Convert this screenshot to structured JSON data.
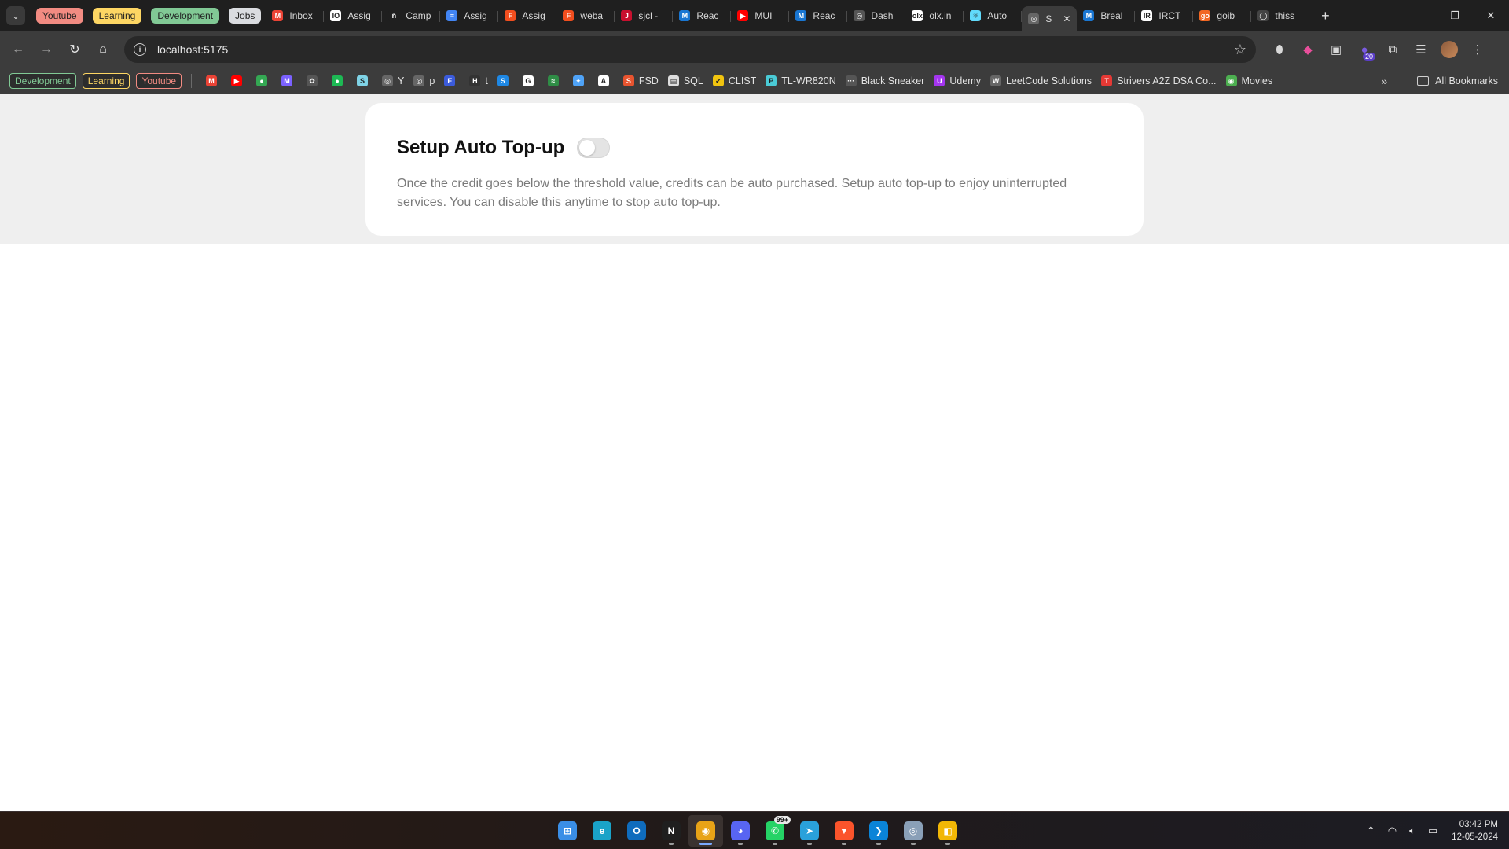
{
  "browser": {
    "tab_groups": [
      {
        "label": "Youtube",
        "bg": "#f28b82"
      },
      {
        "label": "Learning",
        "bg": "#fdd663"
      },
      {
        "label": "Development",
        "bg": "#81c995"
      },
      {
        "label": "Jobs",
        "bg": "#dadce0"
      }
    ],
    "tabs": [
      {
        "label": "Inbox",
        "icon": "gmail-icon",
        "color": "#ea4335",
        "glyph": "M"
      },
      {
        "label": "Assig",
        "icon": "assignment-icon",
        "color": "#ffffff",
        "glyph": "IO"
      },
      {
        "label": "Camp",
        "icon": "camp-icon",
        "color": "#1f1f1f",
        "glyph": "ñ"
      },
      {
        "label": "Assig",
        "icon": "docs-icon",
        "color": "#4285f4",
        "glyph": "≡"
      },
      {
        "label": "Assig",
        "icon": "figma-icon",
        "color": "#f24e1e",
        "glyph": "F"
      },
      {
        "label": "weba",
        "icon": "figma-icon",
        "color": "#f24e1e",
        "glyph": "F"
      },
      {
        "label": "sjcl -",
        "icon": "sjcl-icon",
        "color": "#c8102e",
        "glyph": "J"
      },
      {
        "label": "Reac",
        "icon": "mui-icon",
        "color": "#1976d2",
        "glyph": "M"
      },
      {
        "label": "MUI",
        "icon": "youtube-icon",
        "color": "#ff0000",
        "glyph": "▶"
      },
      {
        "label": "Reac",
        "icon": "mui-icon",
        "color": "#1976d2",
        "glyph": "M"
      },
      {
        "label": "Dash",
        "icon": "globe-icon",
        "color": "#555555",
        "glyph": "◎"
      },
      {
        "label": "olx.in",
        "icon": "olx-icon",
        "color": "#ffffff",
        "glyph": "olx"
      },
      {
        "label": "Auto",
        "icon": "react-icon",
        "color": "#61dafb",
        "glyph": "⚛"
      },
      {
        "label": "S",
        "icon": "globe-icon",
        "color": "#666666",
        "glyph": "◎",
        "active": true
      },
      {
        "label": "Breal",
        "icon": "mui-icon",
        "color": "#1976d2",
        "glyph": "M"
      },
      {
        "label": "IRCT",
        "icon": "irctc-icon",
        "color": "#ffffff",
        "glyph": "IR"
      },
      {
        "label": "goib",
        "icon": "goibibo-icon",
        "color": "#f26722",
        "glyph": "go"
      },
      {
        "label": "thiss",
        "icon": "github-icon",
        "color": "#444444",
        "glyph": "◯"
      }
    ],
    "url": "localhost:5175",
    "extension_badge": "20"
  },
  "bookmarks": {
    "group_chips": [
      {
        "label": "Development",
        "color": "#81c995"
      },
      {
        "label": "Learning",
        "color": "#fdd663"
      },
      {
        "label": "Youtube",
        "color": "#f28b82"
      }
    ],
    "items": [
      {
        "label": "",
        "icon": "gmail-icon",
        "color": "#ea4335",
        "glyph": "M"
      },
      {
        "label": "",
        "icon": "youtube-icon",
        "color": "#ff0000",
        "glyph": "▶"
      },
      {
        "label": "",
        "icon": "maps-icon",
        "color": "#34a853",
        "glyph": "●"
      },
      {
        "label": "",
        "icon": "meet-icon",
        "color": "#7b61ff",
        "glyph": "M"
      },
      {
        "label": "",
        "icon": "openai-icon",
        "color": "#555555",
        "glyph": "✿"
      },
      {
        "label": "",
        "icon": "spotify-icon",
        "color": "#1db954",
        "glyph": "●"
      },
      {
        "label": "",
        "icon": "s-icon",
        "color": "#7fd3e6",
        "glyph": "S"
      },
      {
        "label": "Y",
        "icon": "globe-icon",
        "color": "#666666",
        "glyph": "◎"
      },
      {
        "label": "p",
        "icon": "globe-icon",
        "color": "#666666",
        "glyph": "◎"
      },
      {
        "label": "",
        "icon": "e-icon",
        "color": "#3b5bdb",
        "glyph": "E"
      },
      {
        "label": "t",
        "icon": "h-icon",
        "color": "#333333",
        "glyph": "H"
      },
      {
        "label": "",
        "icon": "s-blue-icon",
        "color": "#1e88e5",
        "glyph": "S"
      },
      {
        "label": "",
        "icon": "google-icon",
        "color": "#ffffff",
        "glyph": "G"
      },
      {
        "label": "",
        "icon": "gfg-icon",
        "color": "#2f8d46",
        "glyph": "≈"
      },
      {
        "label": "",
        "icon": "butterfly-icon",
        "color": "#4fa3f7",
        "glyph": "✦"
      },
      {
        "label": "",
        "icon": "a-icon",
        "color": "#ffffff",
        "glyph": "A"
      },
      {
        "label": "FSD",
        "icon": "fsd-icon",
        "color": "#e8542f",
        "glyph": "S"
      },
      {
        "label": "SQL",
        "icon": "sql-icon",
        "color": "#dddddd",
        "glyph": "▤"
      },
      {
        "label": "CLIST",
        "icon": "clist-icon",
        "color": "#f1c40f",
        "glyph": "✔"
      },
      {
        "label": "TL-WR820N",
        "icon": "tplink-icon",
        "color": "#4acbd6",
        "glyph": "P"
      },
      {
        "label": "Black Sneaker",
        "icon": "sneaker-icon",
        "color": "#555555",
        "glyph": "···"
      },
      {
        "label": "Udemy",
        "icon": "udemy-icon",
        "color": "#a435f0",
        "glyph": "U"
      },
      {
        "label": "LeetCode Solutions",
        "icon": "w-icon",
        "color": "#666666",
        "glyph": "W"
      },
      {
        "label": "Strivers A2Z DSA Co...",
        "icon": "tuf-icon",
        "color": "#e53935",
        "glyph": "T"
      },
      {
        "label": "Movies",
        "icon": "movies-icon",
        "color": "#4caf50",
        "glyph": "◉"
      }
    ],
    "all_bookmarks": "All Bookmarks"
  },
  "page": {
    "card_title": "Setup Auto Top-up",
    "toggle_on": false,
    "description": "Once the credit goes below the threshold value, credits can be auto purchased. Setup auto top-up to enjoy uninterrupted services. You can disable this anytime to stop auto top-up."
  },
  "taskbar": {
    "apps": [
      {
        "name": "start-icon",
        "color": "#3a8ee6",
        "glyph": "⊞"
      },
      {
        "name": "edge-icon",
        "color": "#1aa3c8",
        "glyph": "e"
      },
      {
        "name": "outlook-icon",
        "color": "#0f6cbd",
        "glyph": "O"
      },
      {
        "name": "notion-icon",
        "color": "#1f1f1f",
        "glyph": "N"
      },
      {
        "name": "chrome-icon",
        "color": "#e8a317",
        "glyph": "◉",
        "active": true
      },
      {
        "name": "discord-icon",
        "color": "#5865f2",
        "glyph": "◕"
      },
      {
        "name": "whatsapp-icon",
        "color": "#25d366",
        "glyph": "✆",
        "badge": "99+"
      },
      {
        "name": "telegram-icon",
        "color": "#2aa1db",
        "glyph": "➤"
      },
      {
        "name": "brave-icon",
        "color": "#fb542b",
        "glyph": "▼"
      },
      {
        "name": "vscode-icon",
        "color": "#0a84d8",
        "glyph": "❯"
      },
      {
        "name": "disk-icon",
        "color": "#8aa0b8",
        "glyph": "◎"
      },
      {
        "name": "app-icon",
        "color": "#f2b705",
        "glyph": "◧"
      }
    ],
    "time": "03:42 PM",
    "date": "12-05-2024"
  }
}
